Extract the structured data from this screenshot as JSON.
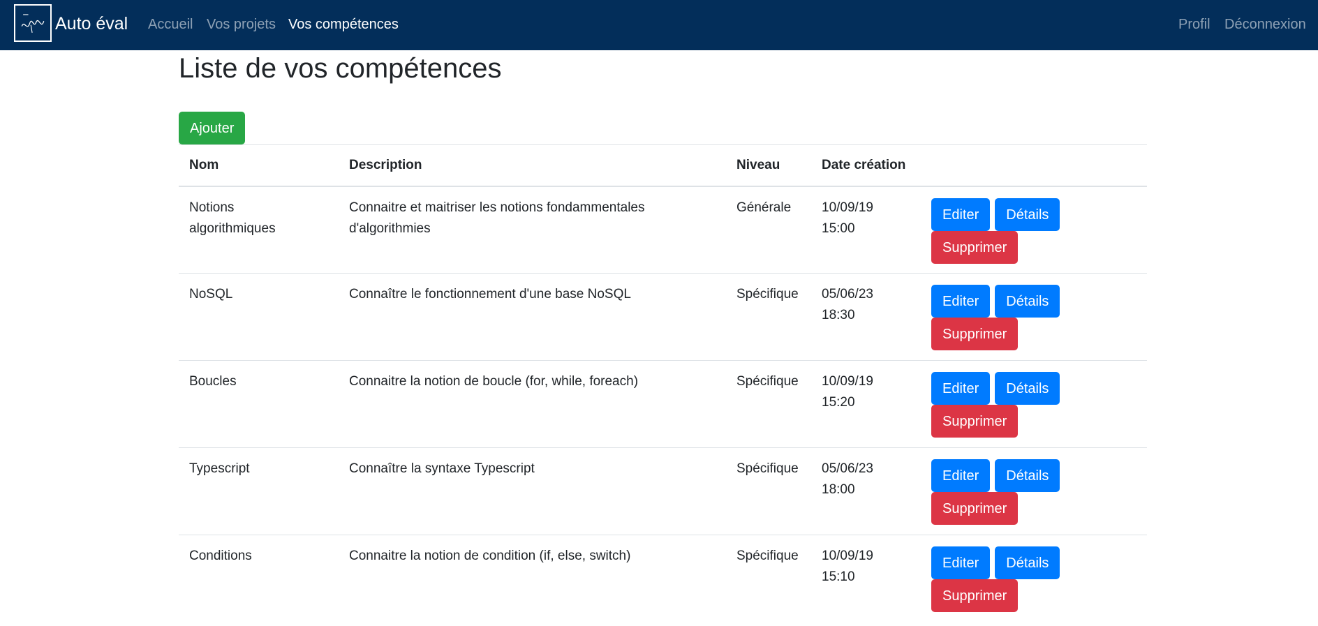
{
  "navbar": {
    "brand": "Auto éval",
    "logo_icon": "school-logo-icon",
    "links": {
      "accueil": "Accueil",
      "projets": "Vos projets",
      "competences": "Vos compétences",
      "profil": "Profil",
      "deconnexion": "Déconnexion"
    },
    "background_color": "#032e5a"
  },
  "page": {
    "title": "Liste de vos compétences",
    "add_button": "Ajouter"
  },
  "table": {
    "headers": {
      "nom": "Nom",
      "description": "Description",
      "niveau": "Niveau",
      "date": "Date création"
    },
    "action_labels": {
      "edit": "Editer",
      "details": "Détails",
      "delete": "Supprimer"
    },
    "rows": [
      {
        "nom_line1": "Notions",
        "nom_line2": "algorithmiques",
        "description_line1": "Connaitre et maitriser les notions fondammentales",
        "description_line2": "d'algorithmies",
        "niveau": "Générale",
        "date_line1": "10/09/19",
        "date_line2": "15:00"
      },
      {
        "nom_line1": "NoSQL",
        "nom_line2": "",
        "description_line1": "Connaître le fonctionnement d'une base NoSQL",
        "description_line2": "",
        "niveau": "Spécifique",
        "date_line1": "05/06/23",
        "date_line2": "18:30"
      },
      {
        "nom_line1": "Boucles",
        "nom_line2": "",
        "description_line1": "Connaitre la notion de boucle (for, while, foreach)",
        "description_line2": "",
        "niveau": "Spécifique",
        "date_line1": "10/09/19",
        "date_line2": "15:20"
      },
      {
        "nom_line1": "Typescript",
        "nom_line2": "",
        "description_line1": "Connaître la syntaxe Typescript",
        "description_line2": "",
        "niveau": "Spécifique",
        "date_line1": "05/06/23",
        "date_line2": "18:00"
      },
      {
        "nom_line1": "Conditions",
        "nom_line2": "",
        "description_line1": "Connaitre la notion de condition (if, else, switch)",
        "description_line2": "",
        "niveau": "Spécifique",
        "date_line1": "10/09/19",
        "date_line2": "15:10"
      }
    ]
  },
  "colors": {
    "success": "#28a745",
    "primary": "#007bff",
    "danger": "#dc3545"
  }
}
